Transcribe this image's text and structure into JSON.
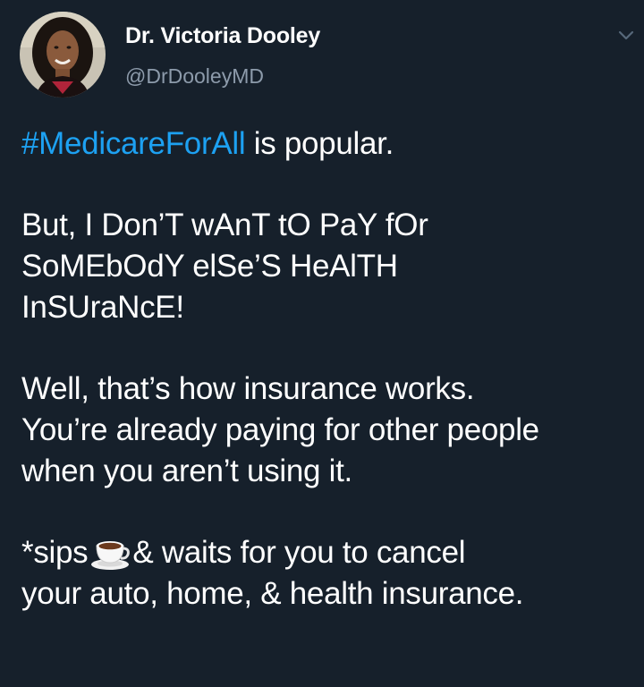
{
  "author": {
    "display_name": "Dr. Victoria Dooley",
    "handle": "@DrDooleyMD",
    "avatar": "profile-photo"
  },
  "menu_icon": "chevron-down-icon",
  "tweet": {
    "p1": {
      "hashtag": "#MedicareForAll",
      "rest": " is popular."
    },
    "p2": {
      "line1": "But, I Don’T wAnT tO PaY fOr",
      "line2": "SoMEbOdY elSe’S HeAlTH",
      "line3": "InSUraNcE!"
    },
    "p3": {
      "line1": "Well, that’s how insurance works.",
      "line2": "You’re already paying for other people",
      "line3": "when you aren’t using it."
    },
    "p4": {
      "before_emoji": "*sips",
      "emoji": "coffee-cup-emoji",
      "after_emoji": "& waits for you to cancel",
      "line2": "your auto, home, & health insurance."
    }
  },
  "colors": {
    "background": "#16202b",
    "text": "#ffffff",
    "handle": "#8d9bab",
    "hashtag": "#1da1f2"
  }
}
